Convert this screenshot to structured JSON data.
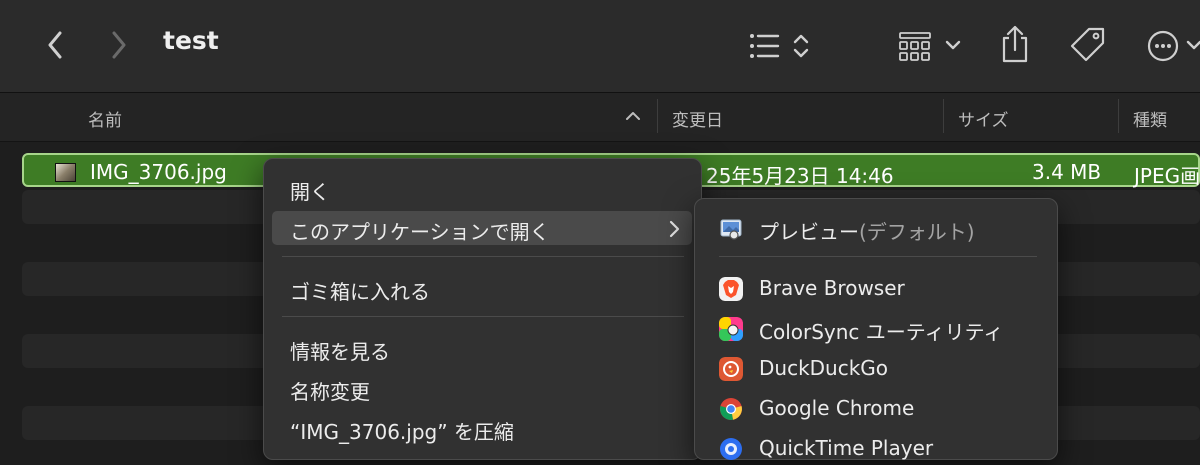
{
  "window": {
    "title": "test"
  },
  "columns": {
    "name": "名前",
    "date": "変更日",
    "size": "サイズ",
    "kind": "種類"
  },
  "selected_file": {
    "name": "IMG_3706.jpg",
    "date": "25年5月23日 14:46",
    "size": "3.4 MB",
    "kind": "JPEG画"
  },
  "context_menu": {
    "open": "開く",
    "open_with": "このアプリケーションで開く",
    "trash": "ゴミ箱に入れる",
    "get_info": "情報を見る",
    "rename": "名称変更",
    "compress": "“IMG_3706.jpg” を圧縮"
  },
  "open_with_menu": {
    "default_app": "プレビュー",
    "default_suffix": "(デフォルト)",
    "apps": [
      "Brave Browser",
      "ColorSync ユーティリティ",
      "DuckDuckGo",
      "Google Chrome",
      "QuickTime Player"
    ]
  },
  "colors": {
    "selection": "#3e7c25",
    "selection_border": "#a7d58a",
    "menu_bg": "#313131",
    "window_bg": "#1e1e1e"
  }
}
